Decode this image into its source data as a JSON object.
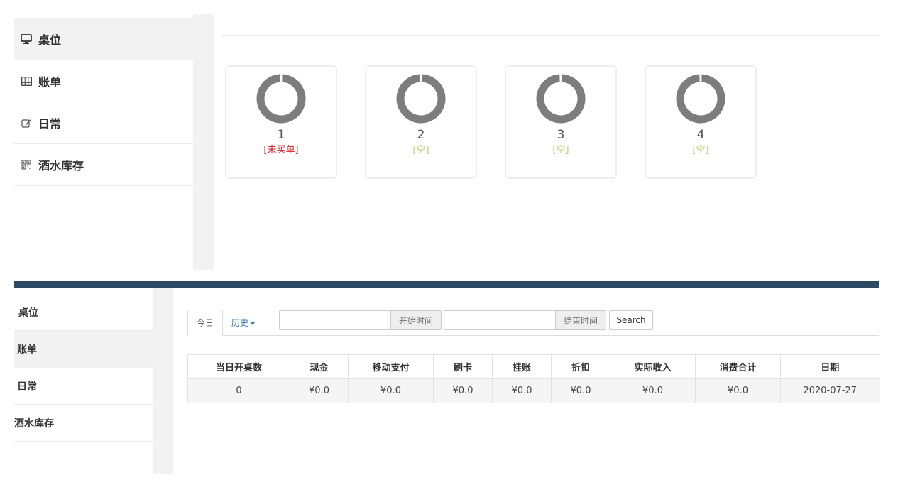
{
  "sidebar": {
    "items": [
      {
        "label": "桌位",
        "icon": "monitor-icon"
      },
      {
        "label": "账单",
        "icon": "table-icon"
      },
      {
        "label": "日常",
        "icon": "edit-icon"
      },
      {
        "label": "酒水库存",
        "icon": "qrcode-icon"
      }
    ]
  },
  "tables": [
    {
      "number": "1",
      "status": "[未买单]",
      "status_color": "#e02020"
    },
    {
      "number": "2",
      "status": "[空]",
      "status_color": "#b9d36f"
    },
    {
      "number": "3",
      "status": "[空]",
      "status_color": "#b9d36f"
    },
    {
      "number": "4",
      "status": "[空]",
      "status_color": "#b9d36f"
    }
  ],
  "colors": {
    "ring": "#7d7d7d",
    "divider": "#2c4a64",
    "link": "#337ab7"
  },
  "bill": {
    "tabs": [
      {
        "label": "今日"
      },
      {
        "label": "历史"
      }
    ],
    "start_time_label": "开始时间",
    "end_time_label": "结束时间",
    "start_time_value": "",
    "end_time_value": "",
    "search_label": "Search",
    "headers": [
      "当日开桌数",
      "现金",
      "移动支付",
      "刷卡",
      "挂账",
      "折扣",
      "实际收入",
      "消费合计",
      "日期"
    ],
    "row": [
      "0",
      "¥0.0",
      "¥0.0",
      "¥0.0",
      "¥0.0",
      "¥0.0",
      "¥0.0",
      "¥0.0",
      "2020-07-27"
    ]
  }
}
